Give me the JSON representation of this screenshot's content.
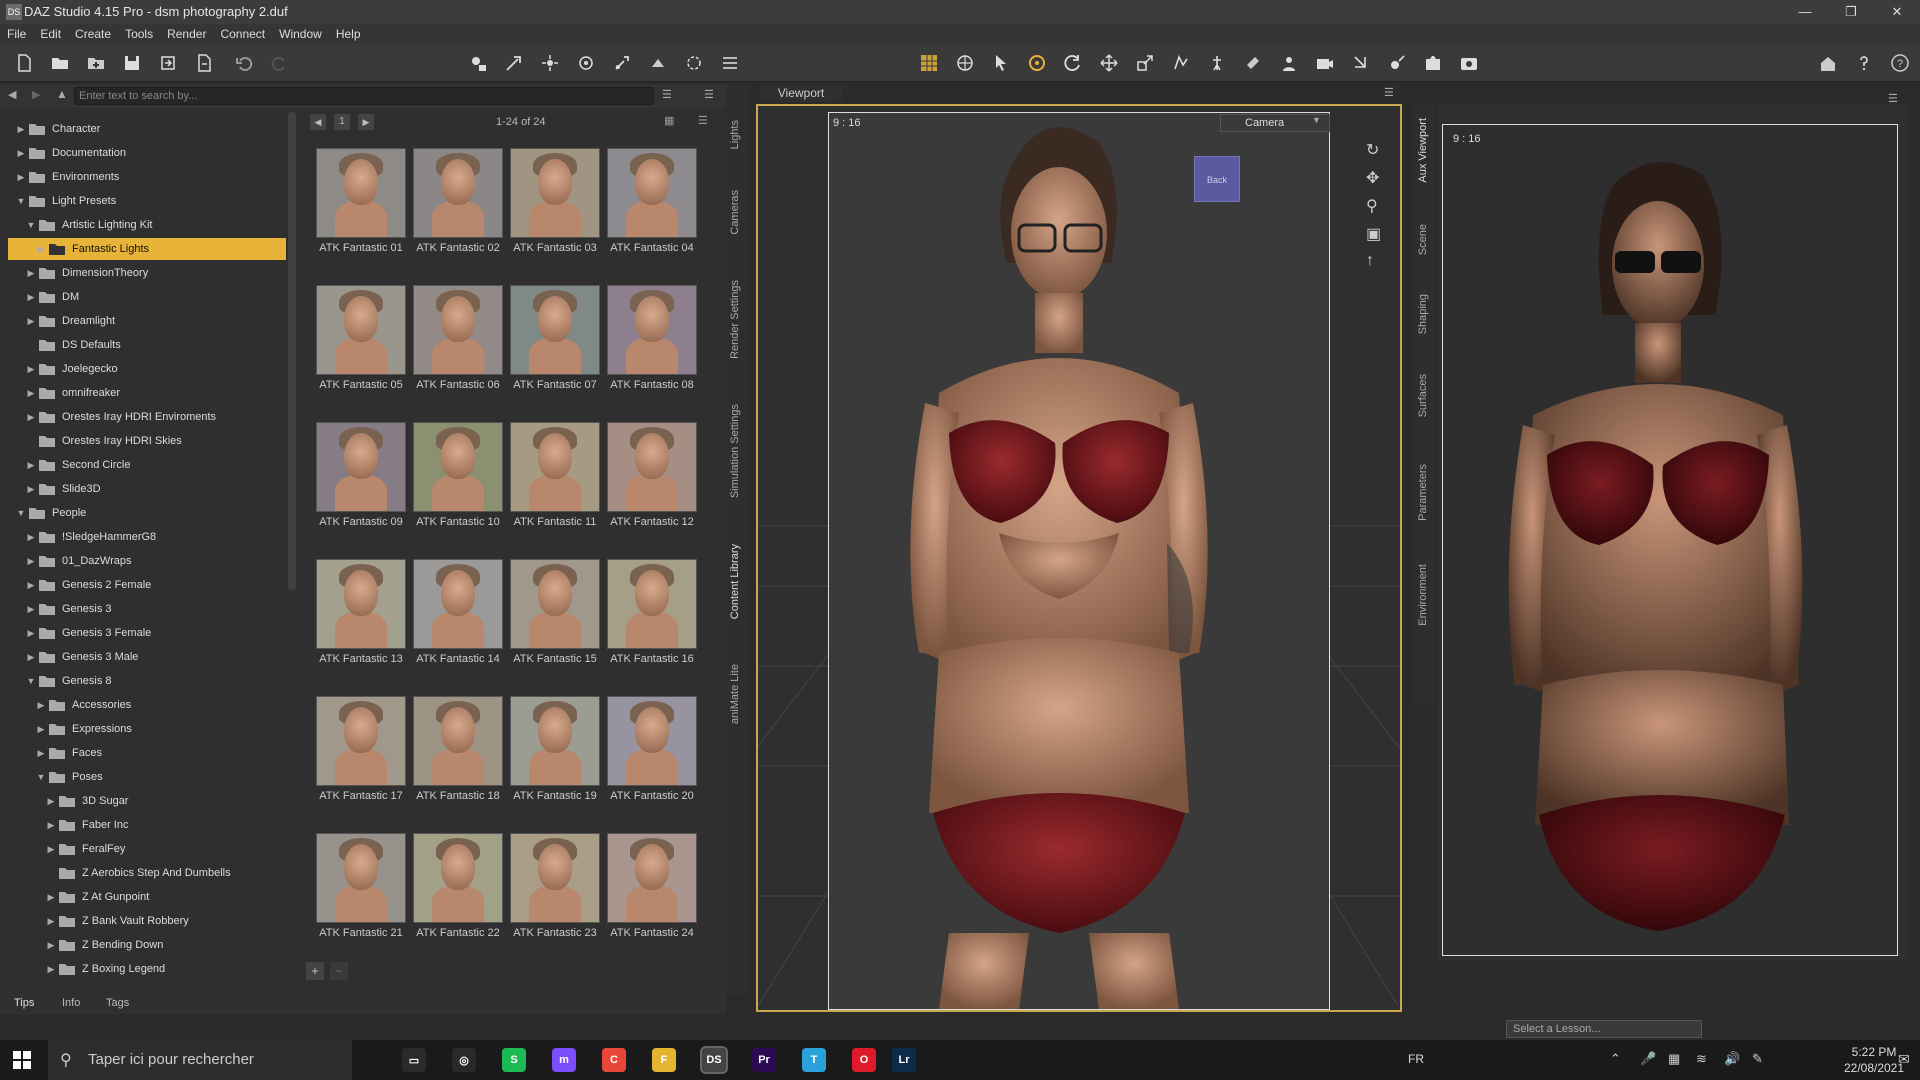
{
  "window": {
    "title": "DAZ Studio 4.15 Pro - dsm photography 2.duf",
    "app_icon": "DS"
  },
  "menu": [
    "File",
    "Edit",
    "Create",
    "Tools",
    "Render",
    "Connect",
    "Window",
    "Help"
  ],
  "search": {
    "placeholder": "Enter text to search by..."
  },
  "tree": [
    {
      "label": "Character",
      "level": 0,
      "expanded": false,
      "selected": false
    },
    {
      "label": "Documentation",
      "level": 0,
      "expanded": false,
      "selected": false
    },
    {
      "label": "Environments",
      "level": 0,
      "expanded": false,
      "selected": false
    },
    {
      "label": "Light Presets",
      "level": 0,
      "expanded": true,
      "selected": false
    },
    {
      "label": "Artistic Lighting Kit",
      "level": 1,
      "expanded": true,
      "selected": false
    },
    {
      "label": "Fantastic Lights",
      "level": 2,
      "expanded": false,
      "selected": true
    },
    {
      "label": "DimensionTheory",
      "level": 1,
      "expanded": false,
      "selected": false
    },
    {
      "label": "DM",
      "level": 1,
      "expanded": false,
      "selected": false
    },
    {
      "label": "Dreamlight",
      "level": 1,
      "expanded": false,
      "selected": false
    },
    {
      "label": "DS Defaults",
      "level": 1,
      "expanded": null,
      "selected": false
    },
    {
      "label": "Joelegecko",
      "level": 1,
      "expanded": false,
      "selected": false
    },
    {
      "label": "omnifreaker",
      "level": 1,
      "expanded": false,
      "selected": false
    },
    {
      "label": "Orestes Iray HDRI Enviroments",
      "level": 1,
      "expanded": false,
      "selected": false
    },
    {
      "label": "Orestes Iray HDRI Skies",
      "level": 1,
      "expanded": null,
      "selected": false
    },
    {
      "label": "Second Circle",
      "level": 1,
      "expanded": false,
      "selected": false
    },
    {
      "label": "Slide3D",
      "level": 1,
      "expanded": false,
      "selected": false
    },
    {
      "label": "People",
      "level": 0,
      "expanded": true,
      "selected": false
    },
    {
      "label": "!SledgeHammerG8",
      "level": 1,
      "expanded": false,
      "selected": false
    },
    {
      "label": "01_DazWraps",
      "level": 1,
      "expanded": false,
      "selected": false
    },
    {
      "label": "Genesis 2 Female",
      "level": 1,
      "expanded": false,
      "selected": false
    },
    {
      "label": "Genesis 3",
      "level": 1,
      "expanded": false,
      "selected": false
    },
    {
      "label": "Genesis 3 Female",
      "level": 1,
      "expanded": false,
      "selected": false
    },
    {
      "label": "Genesis 3 Male",
      "level": 1,
      "expanded": false,
      "selected": false
    },
    {
      "label": "Genesis 8",
      "level": 1,
      "expanded": true,
      "selected": false
    },
    {
      "label": "Accessories",
      "level": 2,
      "expanded": false,
      "selected": false
    },
    {
      "label": "Expressions",
      "level": 2,
      "expanded": false,
      "selected": false
    },
    {
      "label": "Faces",
      "level": 2,
      "expanded": false,
      "selected": false
    },
    {
      "label": "Poses",
      "level": 2,
      "expanded": true,
      "selected": false
    },
    {
      "label": "3D Sugar",
      "level": 3,
      "expanded": false,
      "selected": false
    },
    {
      "label": "Faber Inc",
      "level": 3,
      "expanded": false,
      "selected": false
    },
    {
      "label": "FeralFey",
      "level": 3,
      "expanded": false,
      "selected": false
    },
    {
      "label": "Z Aerobics Step And Dumbells",
      "level": 3,
      "expanded": null,
      "selected": false
    },
    {
      "label": "Z At Gunpoint",
      "level": 3,
      "expanded": false,
      "selected": false
    },
    {
      "label": "Z Bank Vault Robbery",
      "level": 3,
      "expanded": false,
      "selected": false
    },
    {
      "label": "Z Bending Down",
      "level": 3,
      "expanded": false,
      "selected": false
    },
    {
      "label": "Z Boxing Legend",
      "level": 3,
      "expanded": false,
      "selected": false
    }
  ],
  "grid": {
    "page_indicator": "1",
    "count_label": "1-24 of 24",
    "items": [
      "ATK Fantastic 01",
      "ATK Fantastic 02",
      "ATK Fantastic 03",
      "ATK Fantastic 04",
      "ATK Fantastic 05",
      "ATK Fantastic 06",
      "ATK Fantastic 07",
      "ATK Fantastic 08",
      "ATK Fantastic 09",
      "ATK Fantastic 10",
      "ATK Fantastic 11",
      "ATK Fantastic 12",
      "ATK Fantastic 13",
      "ATK Fantastic 14",
      "ATK Fantastic 15",
      "ATK Fantastic 16",
      "ATK Fantastic 17",
      "ATK Fantastic 18",
      "ATK Fantastic 19",
      "ATK Fantastic 20",
      "ATK Fantastic 21",
      "ATK Fantastic 22",
      "ATK Fantastic 23",
      "ATK Fantastic 24"
    ],
    "tints": [
      "#8e8a86",
      "#8a8786",
      "#a09482",
      "#8d8a90",
      "#9a968e",
      "#928a86",
      "#7f8a86",
      "#8e7f8e",
      "#867c86",
      "#8a9070",
      "#a79a82",
      "#a78e84",
      "#a3a18e",
      "#9c9a98",
      "#a0988a",
      "#a69f88",
      "#9f988b",
      "#9d9484",
      "#9b9c92",
      "#9893a0",
      "#97928b",
      "#a2a188",
      "#ab9e88",
      "#aa958f"
    ]
  },
  "left_side_tabs": [
    "Lights",
    "Cameras",
    "Render Settings",
    "Simulation Settings",
    "Content Library",
    "aniMate Lite"
  ],
  "right_side_tabs": [
    "Aux Viewport",
    "Scene",
    "Shaping",
    "Surfaces",
    "Parameters",
    "Environment"
  ],
  "bottom_tabs": [
    "Tips",
    "Info",
    "Tags"
  ],
  "viewport": {
    "tab_label": "Viewport",
    "aspect": "9 : 16",
    "camera": "Camera",
    "cube_label": "Back"
  },
  "aux": {
    "aspect": "9 : 16"
  },
  "lesson": {
    "placeholder": "Select a Lesson..."
  },
  "taskbar": {
    "search_placeholder": "Taper ici pour rechercher",
    "apps": [
      {
        "name": "task-view",
        "label": "▭",
        "color": "#2a2a2a"
      },
      {
        "name": "obs",
        "label": "◎",
        "color": "#2a2a2a"
      },
      {
        "name": "spotify",
        "label": "S",
        "color": "#1db954"
      },
      {
        "name": "messenger",
        "label": "m",
        "color": "#7b4dff"
      },
      {
        "name": "chrome",
        "label": "C",
        "color": "#e9463a"
      },
      {
        "name": "file-explorer",
        "label": "F",
        "color": "#e4b430"
      },
      {
        "name": "daz-studio",
        "label": "DS",
        "color": "#444444"
      },
      {
        "name": "premiere",
        "label": "Pr",
        "color": "#2a0a52"
      },
      {
        "name": "telegram",
        "label": "T",
        "color": "#2aa1da"
      },
      {
        "name": "opera",
        "label": "O",
        "color": "#e01a2a"
      },
      {
        "name": "lightroom",
        "label": "Lr",
        "color": "#0b2d4a"
      }
    ],
    "language": "FR",
    "time": "5:22 PM",
    "date": "22/08/2021"
  },
  "colors": {
    "accent": "#e8b339",
    "viewport_border": "#c8a94e",
    "lingerie": "#6e1419"
  }
}
